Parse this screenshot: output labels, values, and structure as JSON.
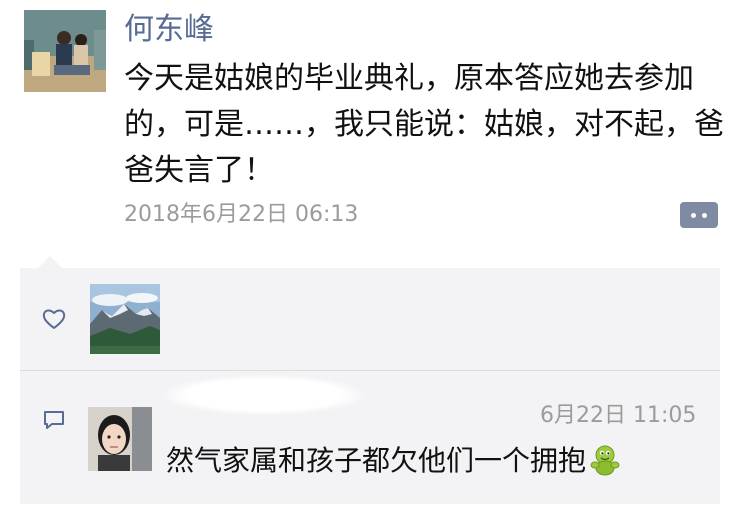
{
  "post": {
    "author": "何东峰",
    "text": "今天是姑娘的毕业典礼，原本答应她去参加的，可是……，我只能说：姑娘，对不起，爸爸失言了！",
    "timestamp": "2018年6月22日 06:13",
    "more_icon": "ellipsis-icon"
  },
  "interactions": {
    "like_icon": "heart-outline-icon",
    "comment_icon": "comment-bubble-icon",
    "comment": {
      "time": "6月22日 11:05",
      "text": "然气家属和孩子都欠他们一个拥抱",
      "emoji": "hug-emoji-icon"
    }
  },
  "colors": {
    "name_link": "#576b95",
    "meta_gray": "#9b9b9b",
    "panel_bg": "#f3f3f5",
    "more_button_bg": "#7f8aa3"
  }
}
